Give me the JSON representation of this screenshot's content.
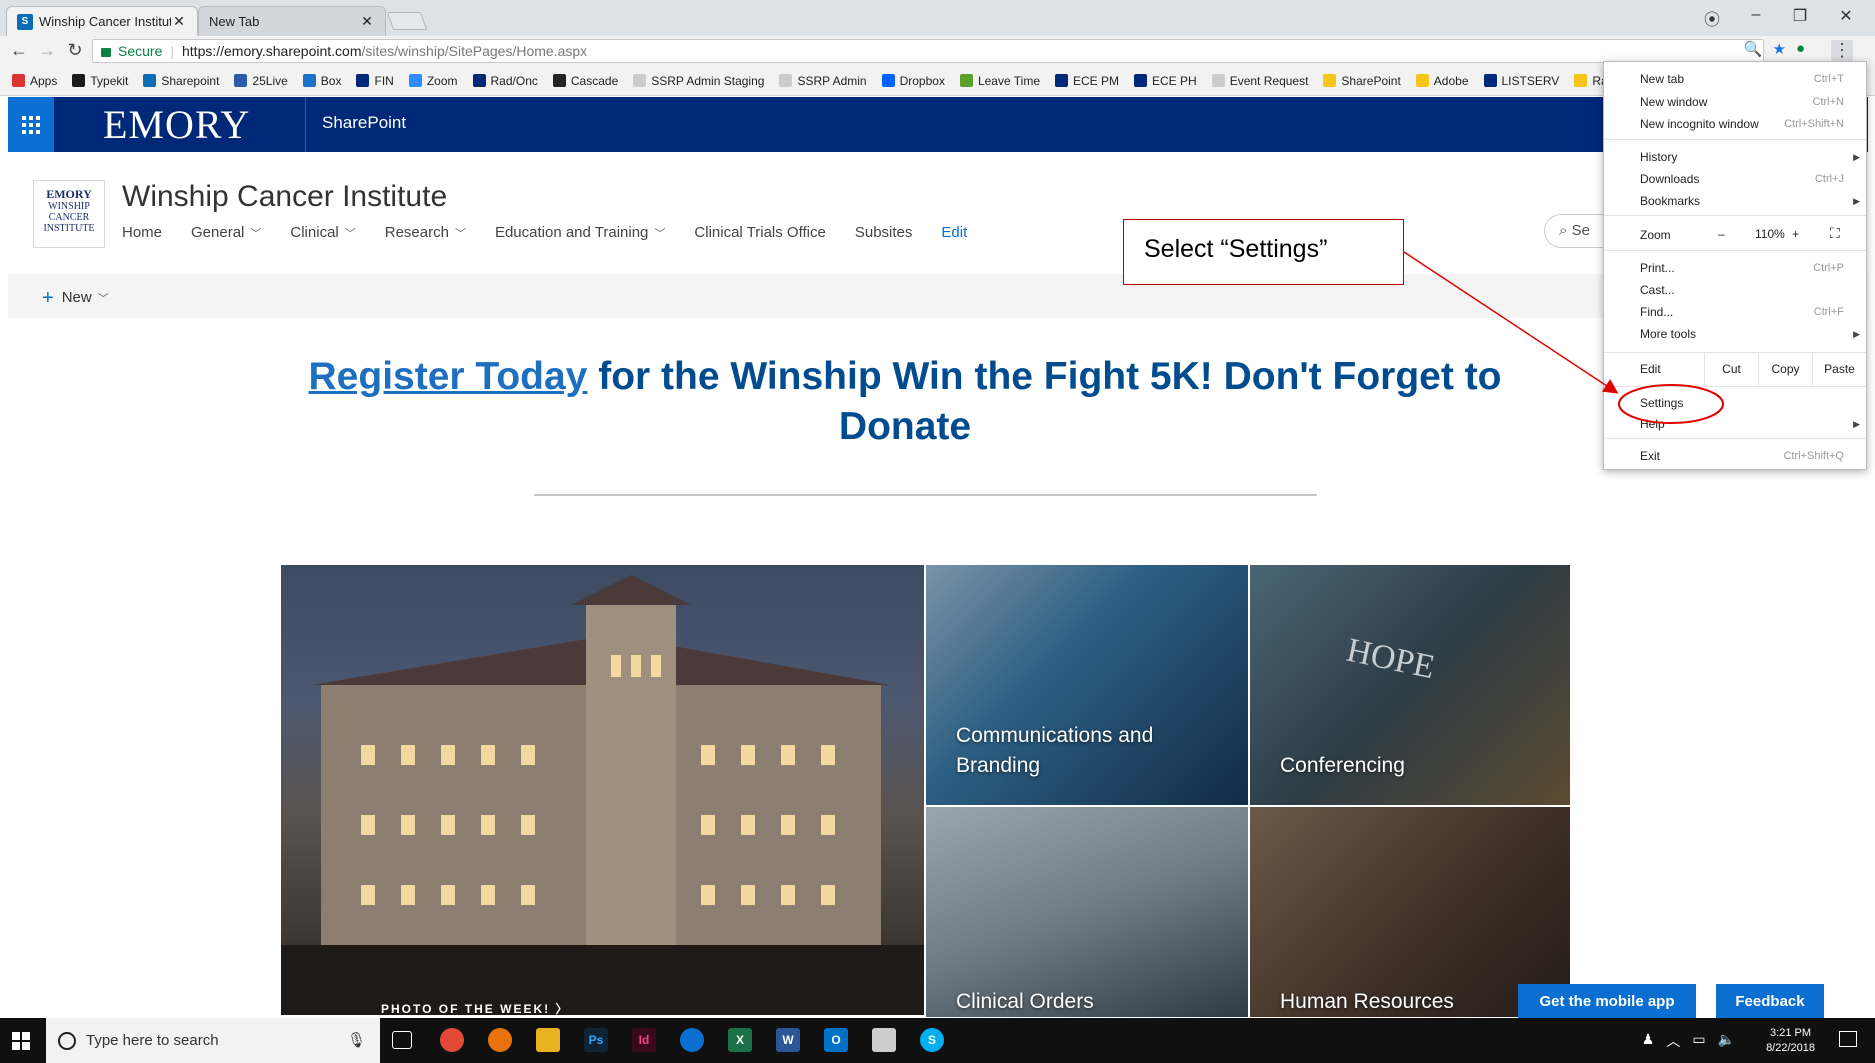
{
  "browser": {
    "tabs": [
      {
        "label": "Winship Cancer Institute",
        "favicon": "S"
      },
      {
        "label": "New Tab"
      }
    ],
    "window_controls": {
      "profile": "⦿",
      "minimize": "–",
      "restore": "❐",
      "close": "✕"
    },
    "address": {
      "secure_label": "Secure",
      "url_main": "https://emory.sharepoint.com",
      "url_rest": "/sites/winship/SitePages/Home.aspx"
    },
    "bookmarks": [
      {
        "label": "Apps",
        "color": "#d33"
      },
      {
        "label": "Typekit",
        "color": "#1a1a1a"
      },
      {
        "label": "Sharepoint",
        "color": "#0b6db6"
      },
      {
        "label": "25Live",
        "color": "#2a5caa"
      },
      {
        "label": "Box",
        "color": "#1b72c7"
      },
      {
        "label": "FIN",
        "color": "#002878"
      },
      {
        "label": "Zoom",
        "color": "#2d8cff"
      },
      {
        "label": "Rad/Onc",
        "color": "#002878"
      },
      {
        "label": "Cascade",
        "color": "#222"
      },
      {
        "label": "SSRP Admin Staging",
        "color": "#ccc"
      },
      {
        "label": "SSRP Admin",
        "color": "#ccc"
      },
      {
        "label": "Dropbox",
        "color": "#0061ff"
      },
      {
        "label": "Leave Time",
        "color": "#5aa02c"
      },
      {
        "label": "ECE PM",
        "color": "#002878"
      },
      {
        "label": "ECE PH",
        "color": "#002878"
      },
      {
        "label": "Event Request",
        "color": "#ccc"
      },
      {
        "label": "SharePoint",
        "color": "#f5c518"
      },
      {
        "label": "Adobe",
        "color": "#f5c518"
      },
      {
        "label": "LISTSERV",
        "color": "#002878"
      },
      {
        "label": "Radia",
        "color": "#f5c518"
      }
    ]
  },
  "suite": {
    "brand": "EMORY",
    "app": "SharePoint"
  },
  "site": {
    "logo": {
      "line1": "EMORY",
      "line2": "WINSHIP",
      "line3": "CANCER",
      "line4": "INSTITUTE"
    },
    "title": "Winship Cancer Institute",
    "nav": [
      {
        "label": "Home",
        "dropdown": false
      },
      {
        "label": "General",
        "dropdown": true
      },
      {
        "label": "Clinical",
        "dropdown": true
      },
      {
        "label": "Research",
        "dropdown": true
      },
      {
        "label": "Education and Training",
        "dropdown": true
      },
      {
        "label": "Clinical Trials Office",
        "dropdown": false
      },
      {
        "label": "Subsites",
        "dropdown": false
      }
    ],
    "edit_label": "Edit",
    "search_placeholder": "Se",
    "new_label": "New"
  },
  "content": {
    "headline_link": "Register Today",
    "headline_rest": " for the Winship Win the Fight 5K! Don't Forget to Donate",
    "tiles": {
      "communications": "Communications and Branding",
      "conferencing": "Conferencing",
      "clinical_orders": "Clinical Orders",
      "human_resources": "Human Resources",
      "photo_of_week": "PHOTO OF THE WEEK!"
    },
    "mobile_app": "Get the mobile app",
    "feedback": "Feedback"
  },
  "annotation": {
    "callout": "Select “Settings”"
  },
  "menu": {
    "new_tab": "New tab",
    "new_tab_sc": "Ctrl+T",
    "new_window": "New window",
    "new_window_sc": "Ctrl+N",
    "incognito": "New incognito window",
    "incognito_sc": "Ctrl+Shift+N",
    "history": "History",
    "downloads": "Downloads",
    "downloads_sc": "Ctrl+J",
    "bookmarks": "Bookmarks",
    "zoom": "Zoom",
    "zoom_minus": "–",
    "zoom_value": "110%",
    "zoom_plus": "+",
    "print": "Print...",
    "print_sc": "Ctrl+P",
    "cast": "Cast...",
    "find": "Find...",
    "find_sc": "Ctrl+F",
    "more_tools": "More tools",
    "edit": "Edit",
    "cut": "Cut",
    "copy": "Copy",
    "paste": "Paste",
    "settings": "Settings",
    "help": "Help",
    "exit": "Exit",
    "exit_sc": "Ctrl+Shift+Q"
  },
  "taskbar": {
    "search_placeholder": "Type here to search",
    "time": "3:21 PM",
    "date": "8/22/2018"
  }
}
